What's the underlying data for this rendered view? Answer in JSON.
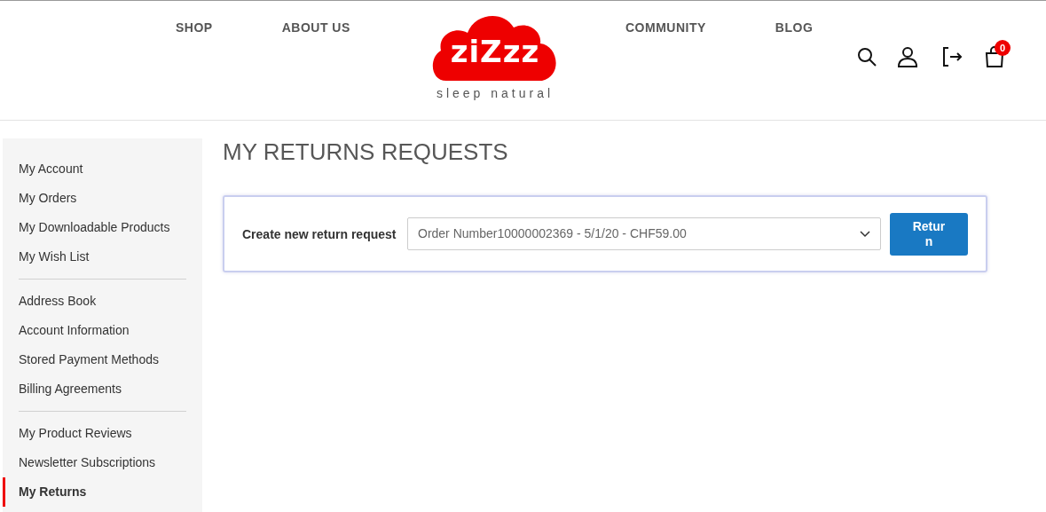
{
  "header": {
    "nav_left": [
      "SHOP",
      "ABOUT US"
    ],
    "nav_right": [
      "COMMUNITY",
      "BLOG"
    ],
    "logo": {
      "name": "ziZzz",
      "tagline": "sleep natural"
    },
    "cart_count": "0"
  },
  "sidebar": {
    "groups": [
      [
        {
          "label": "My Account",
          "selected": false
        },
        {
          "label": "My Orders",
          "selected": false
        },
        {
          "label": "My Downloadable Products",
          "selected": false
        },
        {
          "label": "My Wish List",
          "selected": false
        }
      ],
      [
        {
          "label": "Address Book",
          "selected": false
        },
        {
          "label": "Account Information",
          "selected": false
        },
        {
          "label": "Stored Payment Methods",
          "selected": false
        },
        {
          "label": "Billing Agreements",
          "selected": false
        }
      ],
      [
        {
          "label": "My Product Reviews",
          "selected": false
        },
        {
          "label": "Newsletter Subscriptions",
          "selected": false
        },
        {
          "label": "My Returns",
          "selected": true
        }
      ]
    ]
  },
  "page_title": "MY RETURNS REQUESTS",
  "return_form": {
    "label": "Create new return request",
    "order_select": {
      "value": "Order Number10000002369 - 5/1/20 - CHF59.00"
    },
    "button": "Return"
  }
}
